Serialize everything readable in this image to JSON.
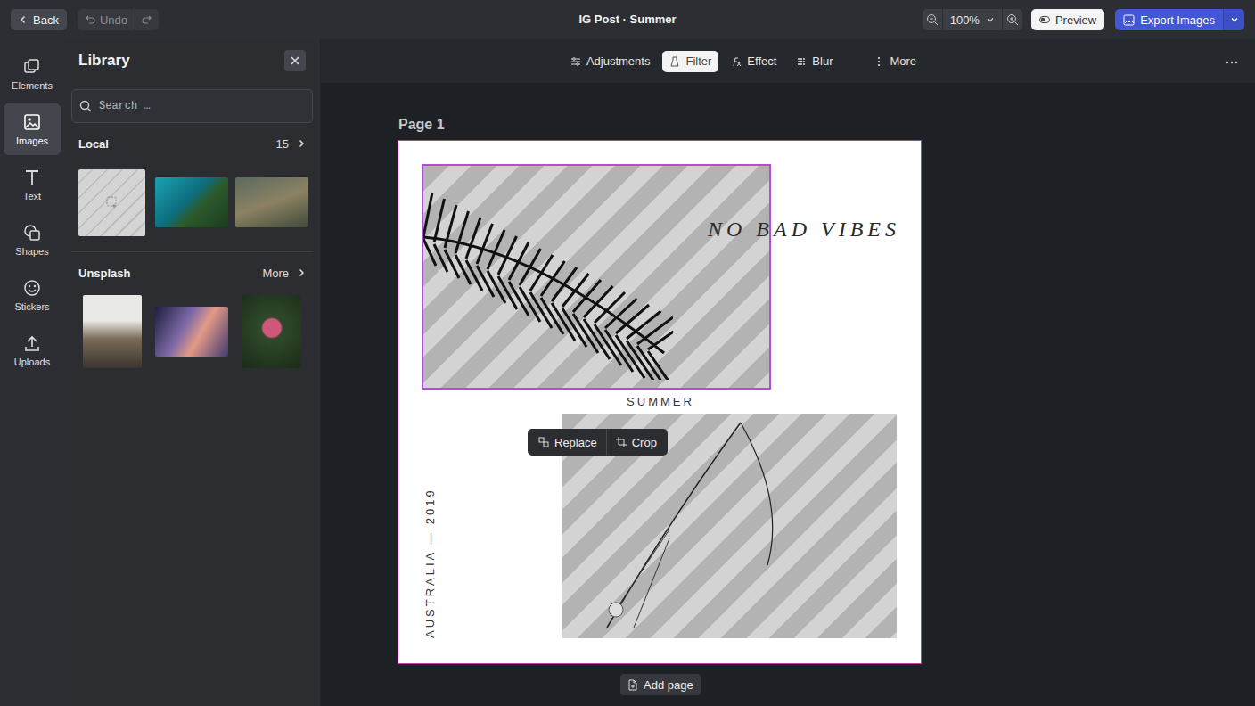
{
  "topbar": {
    "back": "Back",
    "undo": "Undo",
    "title": "IG Post · Summer",
    "zoom": "100%",
    "preview": "Preview",
    "export": "Export Images"
  },
  "rail": [
    {
      "label": "Elements",
      "selected": false
    },
    {
      "label": "Images",
      "selected": true
    },
    {
      "label": "Text",
      "selected": false
    },
    {
      "label": "Shapes",
      "selected": false
    },
    {
      "label": "Stickers",
      "selected": false
    },
    {
      "label": "Uploads",
      "selected": false
    }
  ],
  "library": {
    "title": "Library",
    "search_placeholder": "Search …",
    "sections": [
      {
        "title": "Local",
        "link": "15",
        "thumbs": [
          {
            "kind": "placeholder"
          },
          {
            "kind": "wide"
          },
          {
            "kind": "wide"
          }
        ]
      },
      {
        "title": "Unsplash",
        "link": "More",
        "thumbs": [
          {
            "kind": "tall"
          },
          {
            "kind": "wide"
          },
          {
            "kind": "tall"
          }
        ]
      }
    ]
  },
  "toolbar": [
    {
      "label": "Adjustments",
      "selected": false
    },
    {
      "label": "Filter",
      "selected": true
    },
    {
      "label": "Effect",
      "selected": false
    },
    {
      "label": "Blur",
      "selected": false
    },
    {
      "label": "More",
      "selected": false
    }
  ],
  "page": {
    "label": "Page 1",
    "headline": "NO BAD VIBES",
    "subtitle": "SUMMER",
    "vertical": "AUSTRALIA — 2019",
    "images": [
      {
        "selected": true
      },
      {
        "selected": false
      }
    ],
    "popup": [
      "Replace",
      "Crop"
    ]
  },
  "add_page": "Add page"
}
